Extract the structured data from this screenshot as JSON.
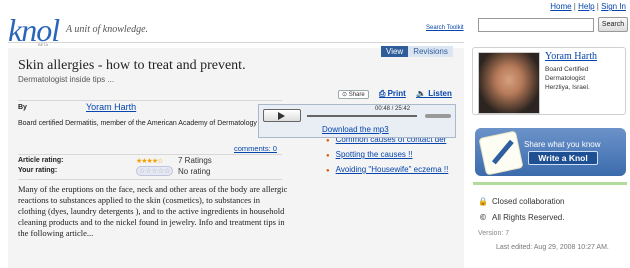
{
  "header": {
    "top_links": [
      "Home",
      "Help",
      "Sign In"
    ],
    "logo_text": "knol",
    "beta_label": "BETA",
    "tagline": "A unit of knowledge.",
    "search_toolkit_label": "Search Toolkit",
    "search_placeholder": "",
    "search_button": "Search"
  },
  "tabs": [
    "View",
    "Revisions"
  ],
  "article": {
    "title": "Skin allergies - how to treat and prevent.",
    "subtitle": "Dermatologist inside tips ...",
    "share_label": "Share",
    "print_label": "Print",
    "listen_label": "Listen",
    "by_label": "By",
    "author_name": "Yoram Harth",
    "author_bio": "Board certified Dermatitis, member of the American Academy of Dermatology",
    "comments_label": "comments: 0",
    "article_rating_label": "Article rating:",
    "article_rating_stars": "★★★★☆",
    "article_rating_text": "7 Ratings",
    "your_rating_label": "Your rating:",
    "your_rating_stars": "☆☆☆☆☆",
    "your_rating_text": "No rating",
    "body_text": "Many of the eruptions on the face, neck and other areas of the body are allergic reactions to substances applied to the skin (cosmetics), to substances in clothing (dyes, laundry detergents ), and to the active ingredients in household cleaning products and to the nickel found in jewelry. Info and treatment tips in the following article..."
  },
  "player": {
    "time": "00:48 / 25:42",
    "progress": 0.03,
    "download_label": "Download the mp3"
  },
  "toc": [
    "Spotting the causes !!",
    "Avoiding \"Housewife\" eczema !!"
  ],
  "toc_partial": "Common causes of contact der",
  "sidebar": {
    "author_name": "Yoram Harth",
    "author_lines": [
      "Board Certified",
      "Dermatologist",
      "Herzliya, Israel."
    ],
    "share_prompt": "Share what you know",
    "write_button": "Write a Knol",
    "collab_label": "Closed collaboration",
    "rights_label": "All Rights Reserved.",
    "version_label": "Version: 7",
    "last_edited": "Last edited: Aug 29, 2008 10:27 AM."
  },
  "colors": {
    "accent_blue": "#2e5d9a",
    "link": "#0645ad",
    "star": "#f5a000",
    "bullet": "#e05a00",
    "green_rule": "#b3dc9c"
  }
}
